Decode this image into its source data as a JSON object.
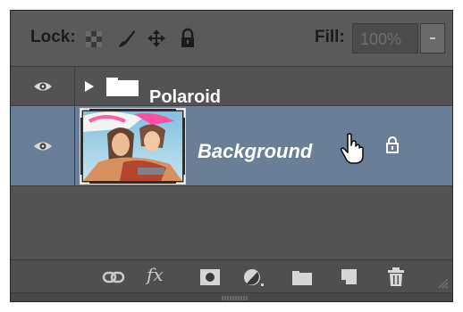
{
  "lock_bar": {
    "lock_label": "Lock:",
    "icons": [
      "lock-transparent-pixels-icon",
      "lock-image-pixels-icon",
      "lock-position-icon",
      "lock-all-icon"
    ],
    "fill_label": "Fill:",
    "fill_value": "100%"
  },
  "layers": [
    {
      "name": "Polaroid",
      "type": "group",
      "expanded": false,
      "visible": true,
      "selected": false
    },
    {
      "name": "Background",
      "type": "image",
      "visible": true,
      "selected": true,
      "locked": true
    }
  ],
  "toolbar": {
    "fx_label": "fx",
    "icons": [
      "link-layers-icon",
      "layer-style-icon",
      "add-mask-icon",
      "adjustment-layer-icon",
      "new-group-icon",
      "new-layer-icon",
      "delete-layer-icon"
    ]
  },
  "colors": {
    "panel_bg": "#535353",
    "selected_row": "#6b7e97",
    "label_dark": "#1c1c1c",
    "disabled_text": "#6e6e6e"
  }
}
